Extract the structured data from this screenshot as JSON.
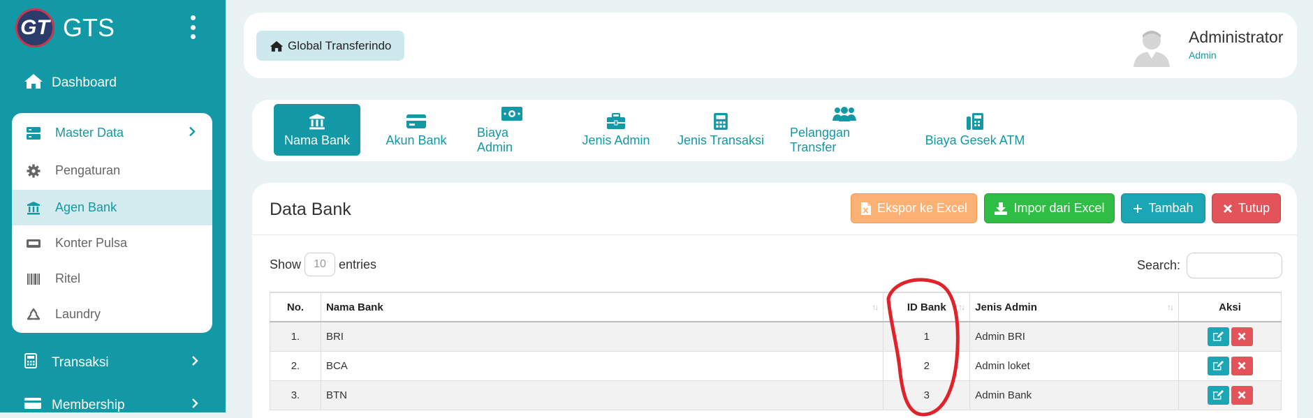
{
  "brand": {
    "name": "GTS",
    "logo_text": "GT"
  },
  "sidebar": {
    "dashboard": "Dashboard",
    "master": {
      "label": "Master Data"
    },
    "items": [
      {
        "label": "Pengaturan",
        "icon": "gear-icon"
      },
      {
        "label": "Agen Bank",
        "icon": "bank-icon"
      },
      {
        "label": "Konter Pulsa",
        "icon": "printer-icon"
      },
      {
        "label": "Ritel",
        "icon": "barcode-icon"
      },
      {
        "label": "Laundry",
        "icon": "recycle-icon"
      }
    ],
    "transaksi": "Transaksi",
    "membership": "Membership"
  },
  "header": {
    "breadcrumb": "Global Transferindo",
    "user_name": "Administrator",
    "user_role": "Admin"
  },
  "tabs": [
    {
      "label": "Nama Bank",
      "icon": "bank-icon"
    },
    {
      "label": "Akun Bank",
      "icon": "credit-card-icon"
    },
    {
      "label": "Biaya Admin",
      "icon": "money-bill-icon"
    },
    {
      "label": "Jenis Admin",
      "icon": "briefcase-icon"
    },
    {
      "label": "Jenis Transaksi",
      "icon": "calculator-icon"
    },
    {
      "label": "Pelanggan Transfer",
      "icon": "users-icon"
    },
    {
      "label": "Biaya Gesek ATM",
      "icon": "fax-icon"
    }
  ],
  "card": {
    "title": "Data Bank",
    "buttons": {
      "export": "Ekspor ke Excel",
      "import": "Impor dari Excel",
      "add": "Tambah",
      "close": "Tutup"
    },
    "show_label": "Show",
    "entries_value": "10",
    "entries_label": "entries",
    "search_label": "Search:"
  },
  "table": {
    "headers": [
      "No.",
      "Nama Bank",
      "ID Bank",
      "Jenis Admin",
      "Aksi"
    ],
    "rows": [
      {
        "no": "1.",
        "nama": "BRI",
        "id": "1",
        "jenis": "Admin BRI"
      },
      {
        "no": "2.",
        "nama": "BCA",
        "id": "2",
        "jenis": "Admin loket"
      },
      {
        "no": "3.",
        "nama": "BTN",
        "id": "3",
        "jenis": "Admin Bank"
      }
    ]
  },
  "colors": {
    "primary": "#1398a5",
    "orange": "#fbb074",
    "green": "#2fbd45",
    "red": "#e2545a",
    "annotation": "#e0232b"
  }
}
